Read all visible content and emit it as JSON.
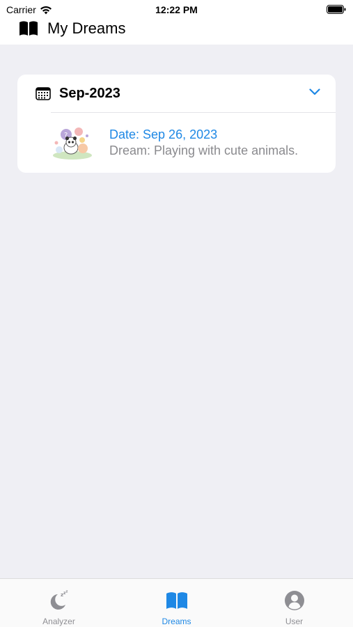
{
  "status_bar": {
    "carrier": "Carrier",
    "time": "12:22 PM"
  },
  "header": {
    "title": "My Dreams",
    "icon": "open-book-icon"
  },
  "month_group": {
    "label": "Sep-2023",
    "icon": "calendar-icon",
    "expanded": true,
    "entries": [
      {
        "date": "Date: Sep 26, 2023",
        "dream": "Dream: Playing with cute animals.",
        "thumbnail": "cute-animals-thumbnail"
      }
    ]
  },
  "tabs": [
    {
      "label": "Analyzer",
      "icon": "moon-zzz-icon",
      "active": false
    },
    {
      "label": "Dreams",
      "icon": "open-book-icon",
      "active": true
    },
    {
      "label": "User",
      "icon": "person-circle-icon",
      "active": false
    }
  ],
  "colors": {
    "accent": "#1e88e5",
    "inactive": "#8e8e93",
    "background": "#efeff4"
  }
}
